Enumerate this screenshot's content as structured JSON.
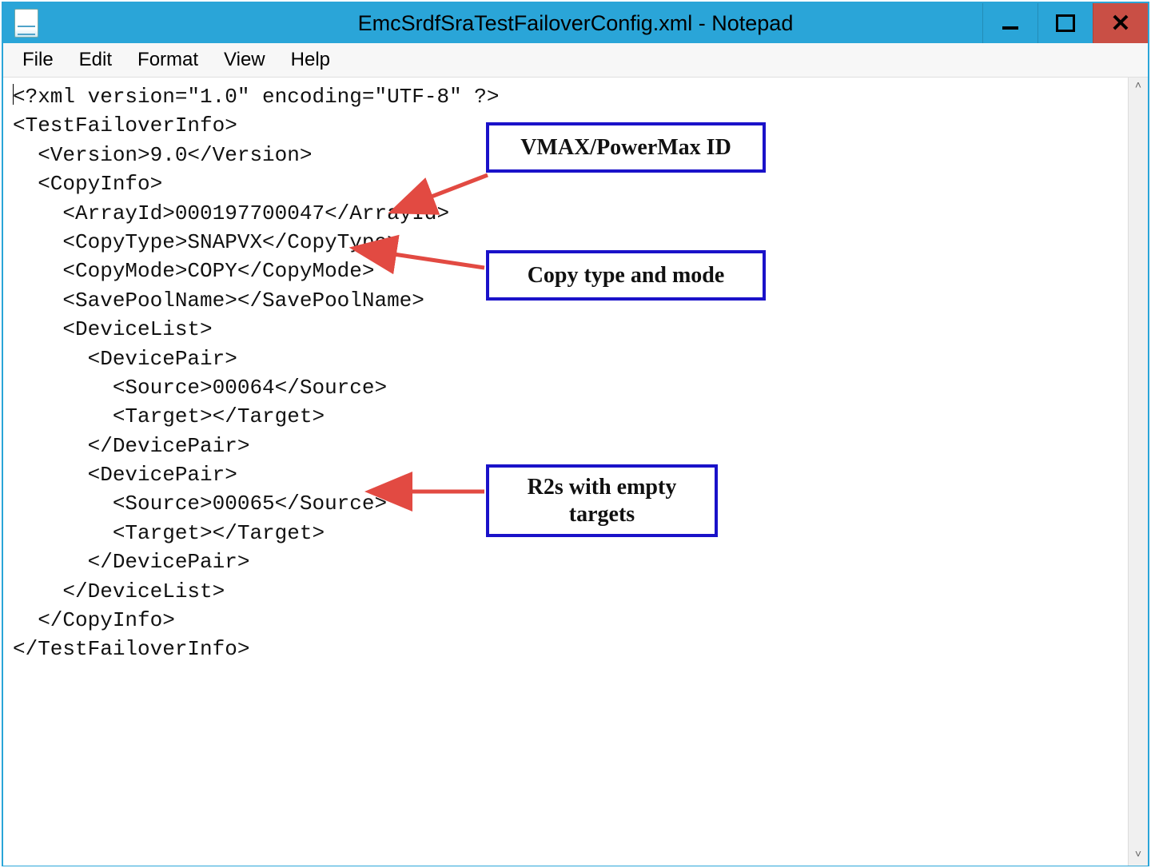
{
  "window": {
    "title": "EmcSrdfSraTestFailoverConfig.xml - Notepad"
  },
  "menu": {
    "file": "File",
    "edit": "Edit",
    "format": "Format",
    "view": "View",
    "help": "Help"
  },
  "xml": {
    "declaration": "<?xml version=\"1.0\" encoding=\"UTF-8\" ?>",
    "root_open": "<TestFailoverInfo>",
    "version_tag": "  <Version>9.0</Version>",
    "copyinfo_open": "  <CopyInfo>",
    "array_id": "    <ArrayId>000197700047</ArrayId>",
    "copy_type": "    <CopyType>SNAPVX</CopyType>",
    "copy_mode": "    <CopyMode>COPY</CopyMode>",
    "save_pool": "    <SavePoolName></SavePoolName>",
    "devicelist_open": "    <DeviceList>",
    "devicepair1_open": "      <DevicePair>",
    "devicepair1_src": "        <Source>00064</Source>",
    "devicepair1_tgt": "        <Target></Target>",
    "devicepair1_close": "      </DevicePair>",
    "devicepair2_open": "      <DevicePair>",
    "devicepair2_src": "        <Source>00065</Source>",
    "devicepair2_tgt": "        <Target></Target>",
    "devicepair2_close": "      </DevicePair>",
    "devicelist_close": "    </DeviceList>",
    "copyinfo_close": "  </CopyInfo>",
    "root_close": "</TestFailoverInfo>"
  },
  "callouts": {
    "array": "VMAX/PowerMax ID",
    "copy": "Copy type and mode",
    "devices": "R2s with empty targets"
  },
  "colors": {
    "titlebar": "#2aa5d8",
    "close": "#c94f45",
    "callout_border": "#1a12c9",
    "arrow": "#e24a42"
  }
}
